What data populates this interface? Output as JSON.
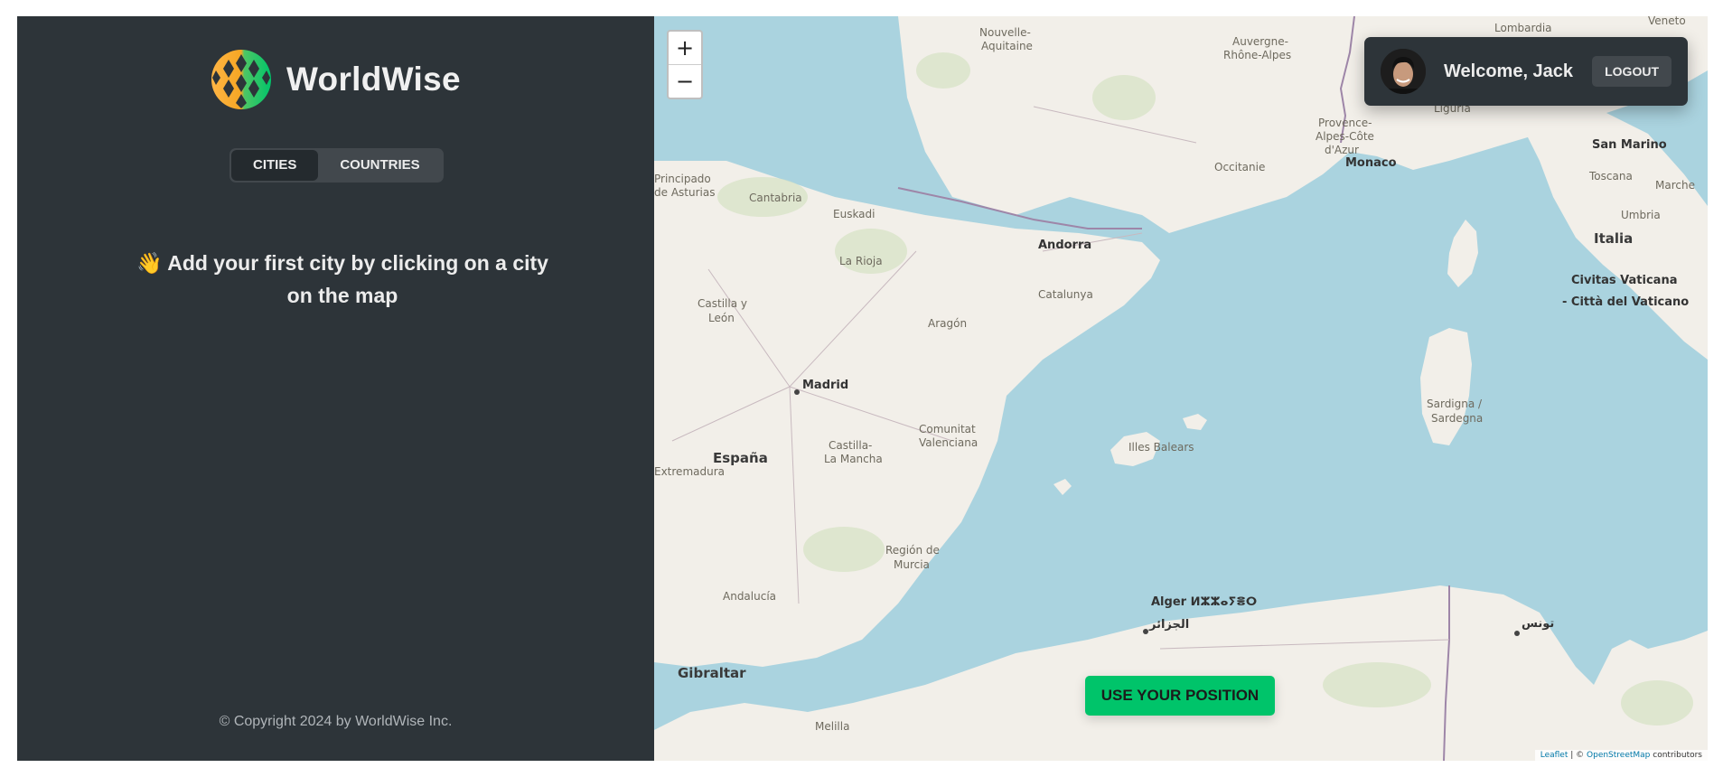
{
  "app": {
    "name": "WorldWise"
  },
  "sidebar": {
    "tabs": [
      {
        "label": "Cities",
        "active": true
      },
      {
        "label": "Countries",
        "active": false
      }
    ],
    "message_emoji": "👋",
    "message": "Add your first city by clicking on a city on the map",
    "footer": "© Copyright 2024 by WorldWise Inc."
  },
  "map": {
    "zoom_in_label": "+",
    "zoom_out_label": "−",
    "user": {
      "welcome": "Welcome, Jack",
      "logout_label": "Logout"
    },
    "use_position_label": "Use your position",
    "attribution": {
      "leaflet": "Leaflet",
      "separator": " | © ",
      "osm": "OpenStreetMap",
      "suffix": " contributors"
    },
    "labels": {
      "nouvelle_aquitaine": "Nouvelle-",
      "aquitaine": "Aquitaine",
      "auvergne": "Auvergne-",
      "rhone_alpes": "Rhône-Alpes",
      "lombardia": "Lombardia",
      "veneto": "Veneto",
      "provence": "Provence-",
      "alpes_cote": "Alpes-Côte",
      "dazur": "d'Azur",
      "occitanie": "Occitanie",
      "monaco": "Monaco",
      "liguria": "Liguria",
      "san_marino": "San Marino",
      "toscana": "Toscana",
      "marche": "Marche",
      "umbria": "Umbria",
      "italia": "Italia",
      "vaticano1": "Civitas Vaticana",
      "vaticano2": "- Città del Vaticano",
      "principado": "Principado",
      "asturias": "de Asturias",
      "cantabria": "Cantabria",
      "euskadi": "Euskadi",
      "andorra": "Andorra",
      "la_rioja": "La Rioja",
      "catalunya": "Catalunya",
      "castilla_leon1": "Castilla y",
      "castilla_leon2": "León",
      "aragon": "Aragón",
      "madrid": "Madrid",
      "espana": "España",
      "castilla_mancha1": "Castilla-",
      "castilla_mancha2": "La Mancha",
      "comunitat1": "Comunitat",
      "comunitat2": "Valenciana",
      "extremadura": "Extremadura",
      "illes_balears": "Illes Balears",
      "sardigna1": "Sardigna /",
      "sardigna2": "Sardegna",
      "region_murcia1": "Región de",
      "region_murcia2": "Murcia",
      "andalucia": "Andalucía",
      "alger": "Alger ⵍⵣⵣⴰⵢⴻⵔ",
      "aljazair": "الجزائر",
      "tunis": "تونس",
      "gibraltar": "Gibraltar",
      "melilla": "Melilla"
    }
  },
  "colors": {
    "sidebar_bg": "#2d3439",
    "accent_green": "#00c46a",
    "sea": "#aad3df",
    "land": "#f2efe9"
  },
  "icons": {
    "logo": "globe-logo-icon",
    "avatar": "user-avatar",
    "wave": "waving-hand-icon"
  }
}
